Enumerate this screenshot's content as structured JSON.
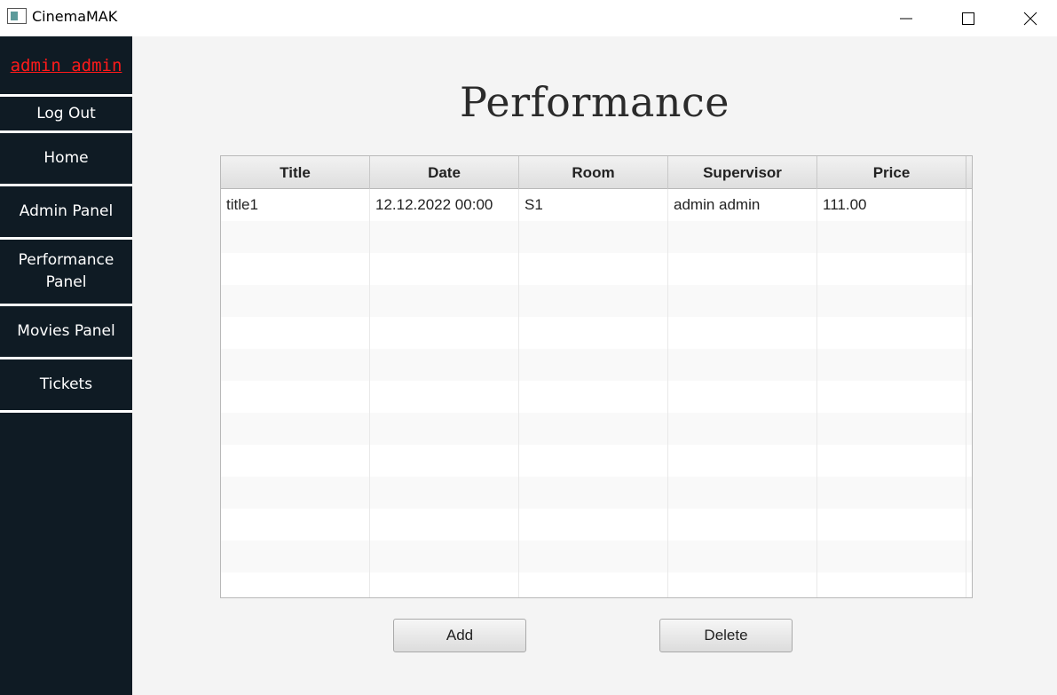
{
  "window": {
    "title": "CinemaMAK"
  },
  "sidebar": {
    "user": "admin admin",
    "items": [
      {
        "label": "Log Out"
      },
      {
        "label": "Home"
      },
      {
        "label": "Admin Panel"
      },
      {
        "label": "Performance Panel"
      },
      {
        "label": "Movies Panel"
      },
      {
        "label": "Tickets"
      }
    ]
  },
  "main": {
    "title": "Performance",
    "table": {
      "columns": [
        "Title",
        "Date",
        "Room",
        "Supervisor",
        "Price"
      ],
      "rows": [
        [
          "title1",
          "12.12.2022 00:00",
          "S1",
          "admin admin",
          "111.00"
        ]
      ]
    },
    "buttons": {
      "add": "Add",
      "delete": "Delete"
    }
  },
  "colors": {
    "sidebar_bg": "#0f1b24",
    "user_link": "#ff1a1a"
  }
}
